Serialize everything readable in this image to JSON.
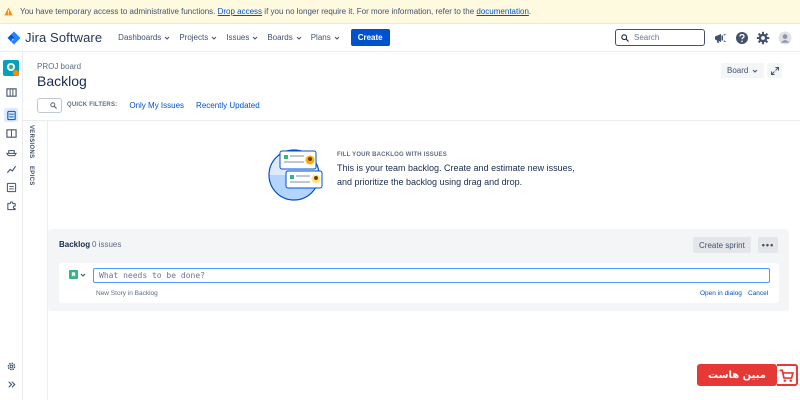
{
  "banner": {
    "text_before": "You have temporary access to administrative functions.",
    "link_drop": "Drop access",
    "text_middle": "if you no longer require it. For more information, refer to the",
    "link_docs": "documentation",
    "text_after": "."
  },
  "app": {
    "name": "Jira Software"
  },
  "nav": {
    "items": [
      "Dashboards",
      "Projects",
      "Issues",
      "Boards",
      "Plans"
    ],
    "create_label": "Create",
    "search_placeholder": "Search"
  },
  "page": {
    "breadcrumb": "PROJ board",
    "title": "Backlog",
    "board_button": "Board"
  },
  "filters": {
    "label": "QUICK FILTERS:",
    "links": [
      "Only My Issues",
      "Recently Updated"
    ]
  },
  "side_tabs": {
    "versions": "VERSIONS",
    "epics": "EPICS"
  },
  "empty_state": {
    "title": "FILL YOUR BACKLOG WITH ISSUES",
    "line1": "This is your team backlog. Create and estimate new issues,",
    "line2": "and prioritize the backlog using drag and drop."
  },
  "backlog": {
    "title": "Backlog",
    "count": "0 issues",
    "create_sprint": "Create sprint",
    "more": "•••",
    "input_placeholder": "What needs to be done?",
    "hint": "New Story in Backlog",
    "open_dialog": "Open in dialog",
    "cancel": "Cancel"
  },
  "watermark": {
    "text": "مبين هاست"
  },
  "colors": {
    "primary": "#0052cc",
    "banner_bg": "#fefae0",
    "warning": "#ff8b00",
    "story": "#36b37e",
    "watermark": "#e53935"
  }
}
